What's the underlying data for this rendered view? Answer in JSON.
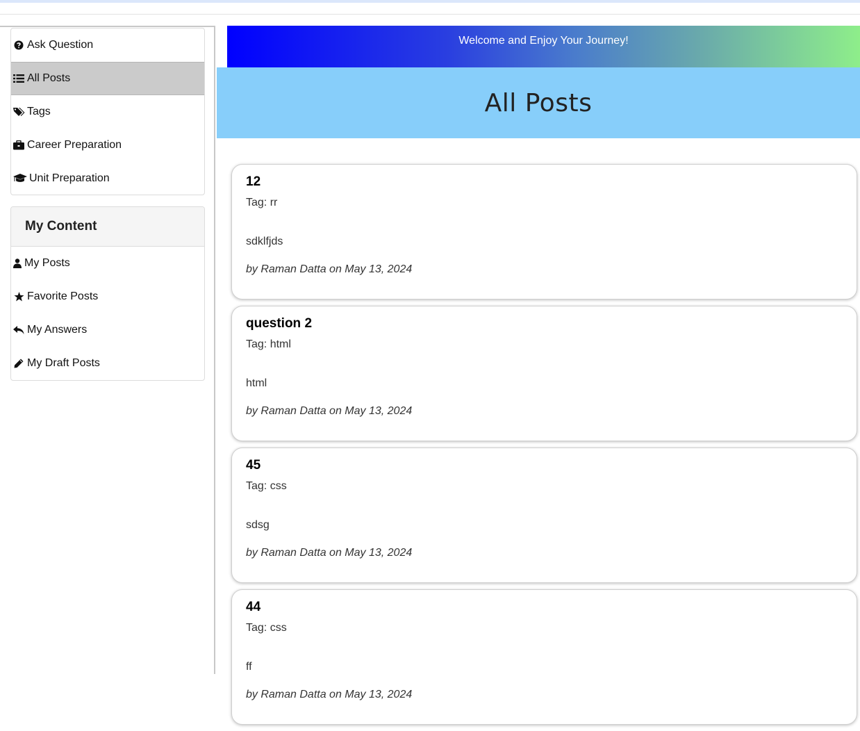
{
  "sidebar": {
    "menu": [
      {
        "label": "Ask Question",
        "icon": "question-circle-icon"
      },
      {
        "label": "All Posts",
        "icon": "list-icon",
        "active": true
      },
      {
        "label": "Tags",
        "icon": "tags-icon"
      },
      {
        "label": "Career Preparation",
        "icon": "briefcase-icon"
      },
      {
        "label": "Unit Preparation",
        "icon": "graduation-cap-icon"
      }
    ],
    "my_content": {
      "title": "My Content",
      "items": [
        {
          "label": "My Posts",
          "icon": "user-icon"
        },
        {
          "label": "Favorite Posts",
          "icon": "star-icon"
        },
        {
          "label": "My Answers",
          "icon": "reply-icon"
        },
        {
          "label": "My Draft Posts",
          "icon": "pencil-icon"
        }
      ]
    }
  },
  "banner": {
    "text": "Welcome and Enjoy Your Journey!"
  },
  "page": {
    "title": "All Posts"
  },
  "posts": [
    {
      "title": "12",
      "tag": "Tag: rr",
      "body": "sdklfjds",
      "meta": "by Raman Datta on May 13, 2024"
    },
    {
      "title": "question 2",
      "tag": "Tag: html",
      "body": "html",
      "meta": "by Raman Datta on May 13, 2024"
    },
    {
      "title": "45",
      "tag": "Tag: css",
      "body": "sdsg",
      "meta": "by Raman Datta on May 13, 2024"
    },
    {
      "title": "44",
      "tag": "Tag: css",
      "body": "ff",
      "meta": "by Raman Datta on May 13, 2024"
    }
  ],
  "colors": {
    "active_item": "#cbcbcb",
    "title_band": "#87cefa",
    "banner_start": "#0000ff",
    "banner_end": "#8eee8a"
  }
}
